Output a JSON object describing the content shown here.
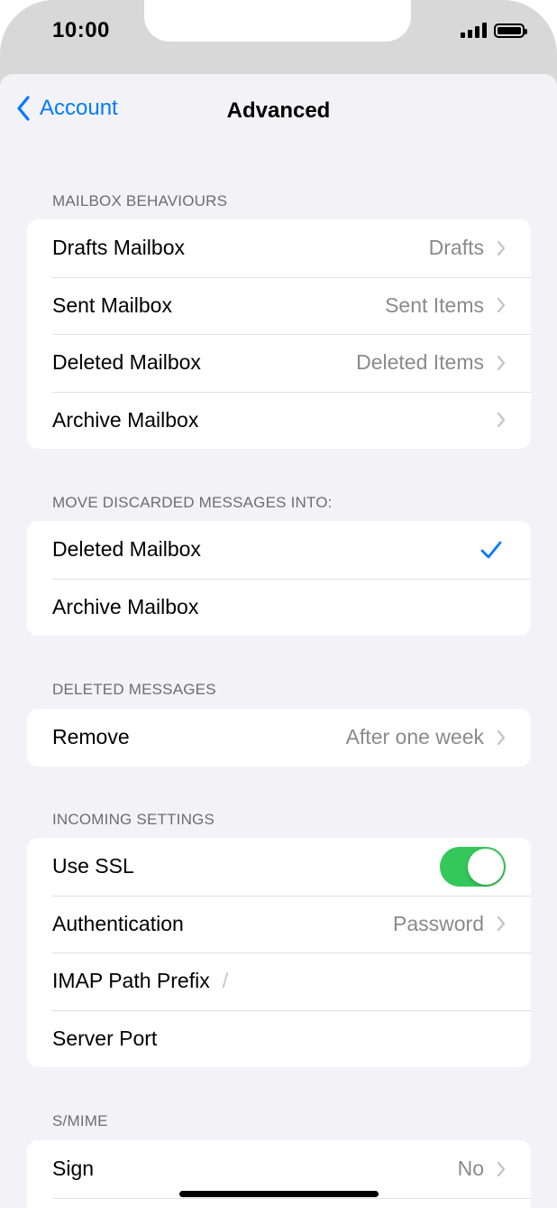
{
  "status_bar": {
    "time": "10:00"
  },
  "nav": {
    "back_label": "Account",
    "title": "Advanced"
  },
  "sections": {
    "mailbox_behaviours": {
      "header": "MAILBOX BEHAVIOURS",
      "rows": [
        {
          "label": "Drafts Mailbox",
          "value": "Drafts"
        },
        {
          "label": "Sent Mailbox",
          "value": "Sent Items"
        },
        {
          "label": "Deleted Mailbox",
          "value": "Deleted Items"
        },
        {
          "label": "Archive Mailbox",
          "value": ""
        }
      ]
    },
    "move_discarded": {
      "header": "MOVE DISCARDED MESSAGES INTO:",
      "rows": [
        {
          "label": "Deleted Mailbox",
          "selected": true
        },
        {
          "label": "Archive Mailbox",
          "selected": false
        }
      ]
    },
    "deleted_messages": {
      "header": "DELETED MESSAGES",
      "rows": [
        {
          "label": "Remove",
          "value": "After one week"
        }
      ]
    },
    "incoming_settings": {
      "header": "INCOMING SETTINGS",
      "use_ssl": {
        "label": "Use SSL",
        "on": true
      },
      "authentication": {
        "label": "Authentication",
        "value": "Password"
      },
      "imap_path_prefix": {
        "label": "IMAP Path Prefix",
        "value": "/"
      },
      "server_port": {
        "label": "Server Port",
        "value": ""
      }
    },
    "smime": {
      "header": "S/MIME",
      "rows": [
        {
          "label": "Sign",
          "value": "No"
        }
      ]
    }
  },
  "colors": {
    "accent": "#007aff",
    "toggle_on": "#34c759",
    "background": "#f2f2f7",
    "secondary_text": "#8a8a8e"
  }
}
